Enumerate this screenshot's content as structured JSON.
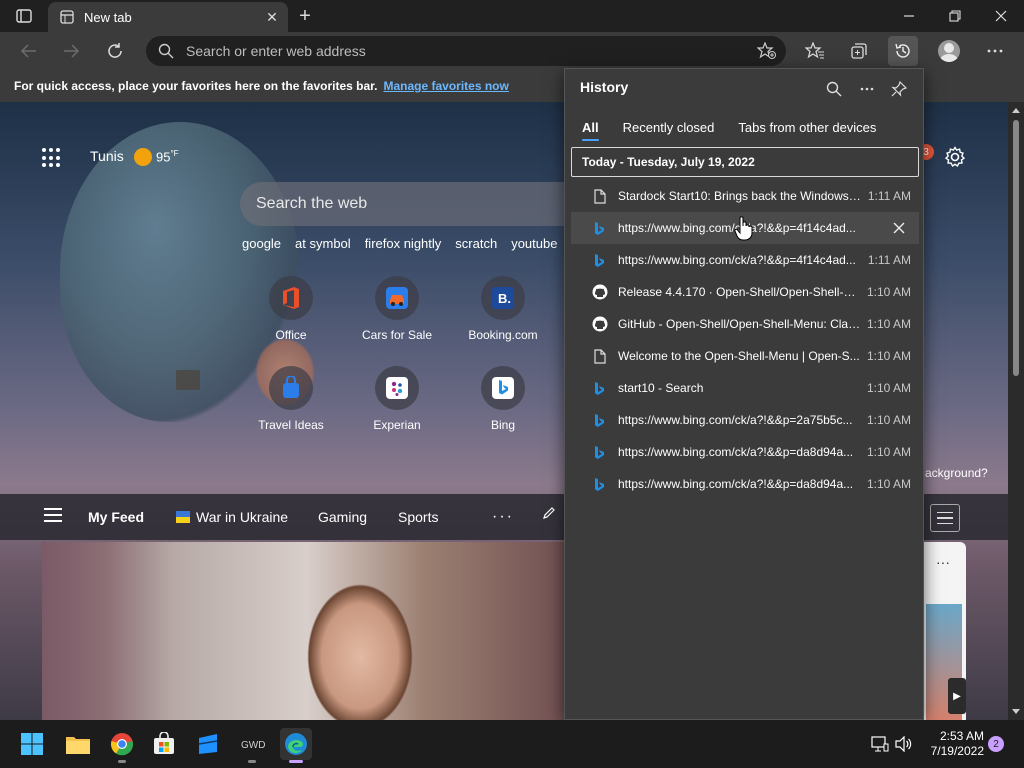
{
  "window": {
    "tab_title": "New tab",
    "new_tab_symbol": "+",
    "close_tab_symbol": "✕"
  },
  "toolbar": {
    "address_placeholder": "Search or enter web address"
  },
  "favorites_bar": {
    "message": "For quick access, place your favorites here on the favorites bar.",
    "link": "Manage favorites now"
  },
  "ntp": {
    "weather_city": "Tunis",
    "weather_temp": "95",
    "weather_unit": "°F",
    "notification_count": "3",
    "search_placeholder": "Search the web",
    "quick_searches": [
      "google",
      "at symbol",
      "firefox nightly",
      "scratch",
      "youtube"
    ],
    "tiles": [
      {
        "label": "Office"
      },
      {
        "label": "Cars for Sale"
      },
      {
        "label": "Booking.com"
      },
      {
        "label": "Travel Ideas"
      },
      {
        "label": "Experian"
      },
      {
        "label": "Bing"
      }
    ],
    "feed": {
      "items": [
        "My Feed",
        "War in Ukraine",
        "Gaming",
        "Sports"
      ],
      "more": "···"
    },
    "background_question": "ackground?"
  },
  "history": {
    "title": "History",
    "tabs": [
      "All",
      "Recently closed",
      "Tabs from other devices"
    ],
    "date_header": "Today - Tuesday, July 19, 2022",
    "entries": [
      {
        "title": "Stardock Start10: Brings back the Windows S...",
        "time": "1:11 AM",
        "icon": "page-icon"
      },
      {
        "title": "https://www.bing.com/ck/a?!&&p=4f14c4ad...",
        "time": "",
        "icon": "bing-icon"
      },
      {
        "title": "https://www.bing.com/ck/a?!&&p=4f14c4ad...",
        "time": "1:11 AM",
        "icon": "bing-icon"
      },
      {
        "title": "Release 4.4.170 · Open-Shell/Open-Shell-Me...",
        "time": "1:10 AM",
        "icon": "github-icon"
      },
      {
        "title": "GitHub - Open-Shell/Open-Shell-Menu: Clas...",
        "time": "1:10 AM",
        "icon": "github-icon"
      },
      {
        "title": "Welcome to the Open-Shell-Menu | Open-S...",
        "time": "1:10 AM",
        "icon": "page-icon"
      },
      {
        "title": "start10 - Search",
        "time": "1:10 AM",
        "icon": "bing-icon"
      },
      {
        "title": "https://www.bing.com/ck/a?!&&p=2a75b5c...",
        "time": "1:10 AM",
        "icon": "bing-icon"
      },
      {
        "title": "https://www.bing.com/ck/a?!&&p=da8d94a...",
        "time": "1:10 AM",
        "icon": "bing-icon"
      },
      {
        "title": "https://www.bing.com/ck/a?!&&p=da8d94a...",
        "time": "1:10 AM",
        "icon": "bing-icon"
      }
    ]
  },
  "taskbar": {
    "time": "2:53 AM",
    "date": "7/19/2022",
    "notification_count": "2"
  },
  "colors": {
    "accent": "#4ca3ff",
    "bing_blue": "#1e90ff",
    "edge_accent": "#c8a4ff"
  }
}
